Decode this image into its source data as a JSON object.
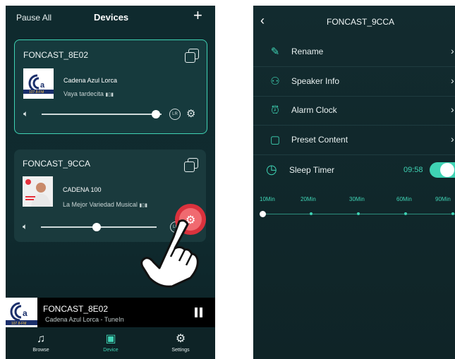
{
  "left": {
    "header": {
      "left_action": "Pause All",
      "title": "Devices",
      "add_icon": "plus-icon"
    },
    "devices": [
      {
        "name": "FONCAST_8E02",
        "station": "Cadena Azul Lorca",
        "subtitle": "Vaya tardecita",
        "volume_fraction": 0.95,
        "lr": "LR"
      },
      {
        "name": "FONCAST_9CCA",
        "station": "CADENA 100",
        "subtitle": "La Mejor Variedad Musical",
        "volume_fraction": 0.48,
        "lr": "LR"
      }
    ],
    "now_playing": {
      "name": "FONCAST_8E02",
      "subtitle": "Cadena Azul Lorca - TuneIn"
    },
    "nav": [
      {
        "label": "Browse",
        "icon": "music-note-icon"
      },
      {
        "label": "Device",
        "icon": "speaker-icon"
      },
      {
        "label": "Settings",
        "icon": "gear-icon"
      }
    ],
    "accent": "#3fd3b4",
    "tap_highlight": "#e5313d"
  },
  "right": {
    "header": {
      "title": "FONCAST_9CCA"
    },
    "menu": [
      {
        "label": "Rename",
        "icon": "edit-icon"
      },
      {
        "label": "Speaker Info",
        "icon": "user-icon"
      },
      {
        "label": "Alarm Clock",
        "icon": "alarm-clock-icon"
      },
      {
        "label": "Preset Content",
        "icon": "save-icon"
      }
    ],
    "sleep_timer": {
      "label": "Sleep Timer",
      "value": "09:58",
      "enabled": true
    },
    "timer_options": [
      "10Min",
      "20Min",
      "30Min",
      "60Min",
      "90Min"
    ],
    "selected_option": "10Min"
  }
}
